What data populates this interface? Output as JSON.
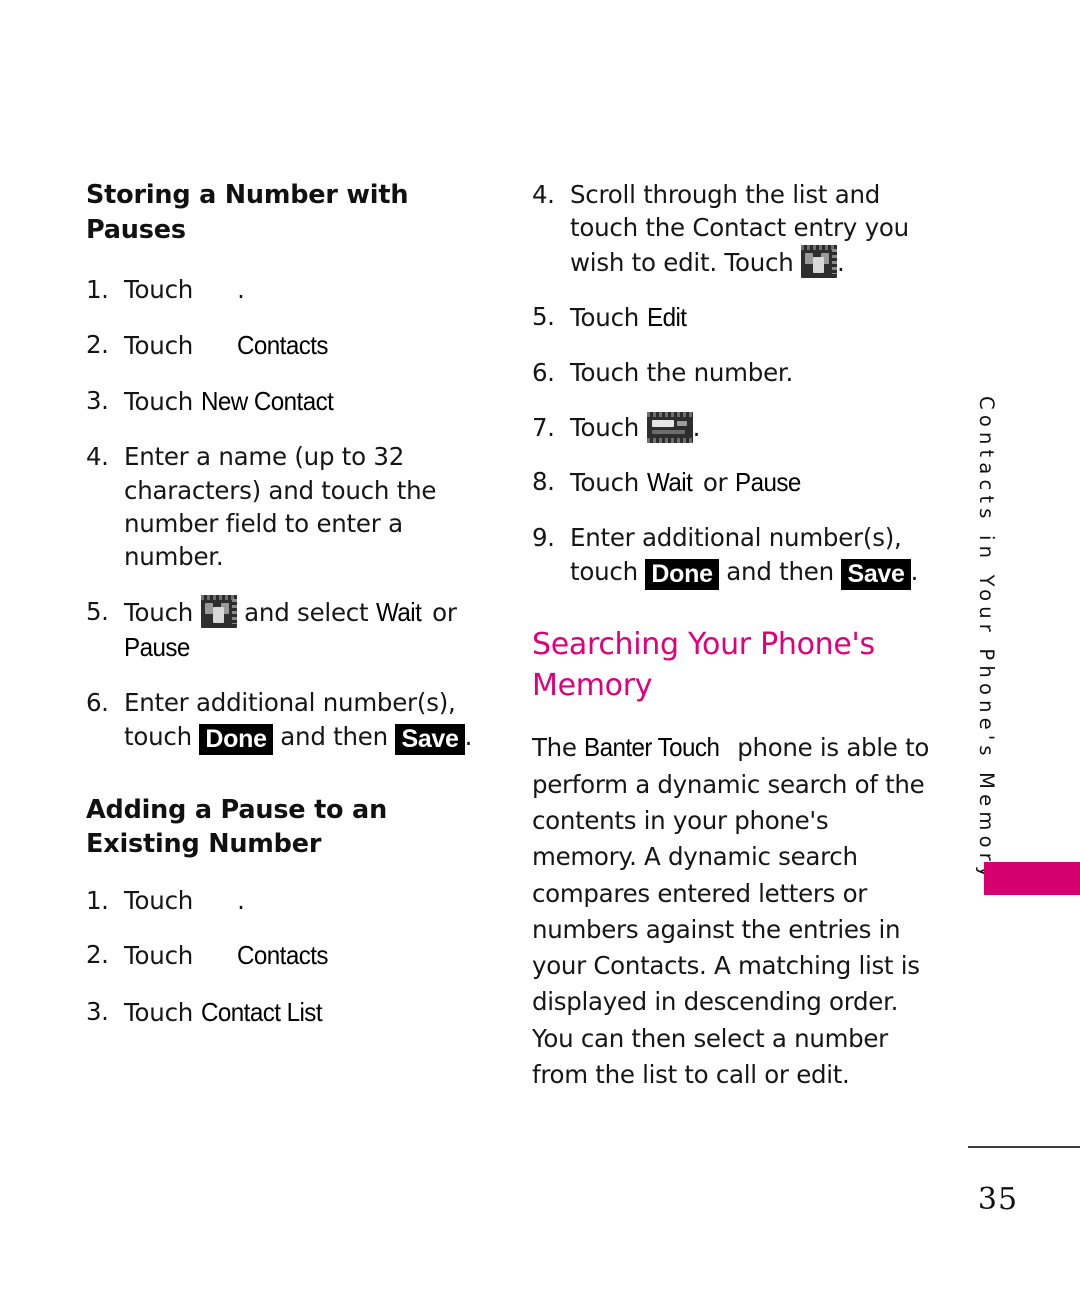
{
  "page": {
    "number": "35",
    "side_tab_label": "Contacts in Your Phone's Memory",
    "accent_pink": "#D4006E",
    "heading_pink": "#E0007C"
  },
  "left_column": {
    "heading_1": "Storing a Number with Pauses",
    "steps_1": [
      {
        "num": "1.",
        "lead": "Touch",
        "icon": "missing-icon-placeholder",
        "tail": "."
      },
      {
        "num": "2.",
        "lead": "Touch",
        "icon": "missing-icon-placeholder",
        "ui_label": "Contacts",
        "tail": ""
      },
      {
        "num": "3.",
        "lead": "Touch",
        "ui_label": "New Contact",
        "tail": ""
      },
      {
        "num": "4.",
        "text": "Enter a name (up to 32 characters) and touch the number field to enter a number."
      },
      {
        "num": "5.",
        "lead": "Touch",
        "icon": "contacts-screen-thumbnail",
        "mid": "and select",
        "ui_label_a": "Wait",
        "conj": "or",
        "ui_label_b": "Pause",
        "tail": ""
      },
      {
        "num": "6.",
        "lead": "Enter additional number(s), touch",
        "key_a": "Done",
        "mid": "and then",
        "key_b": "Save",
        "tail": "."
      }
    ],
    "heading_2": "Adding a Pause to an Existing Number",
    "steps_2": [
      {
        "num": "1.",
        "lead": "Touch",
        "icon": "missing-icon-placeholder",
        "tail": "."
      },
      {
        "num": "2.",
        "lead": "Touch",
        "icon": "missing-icon-placeholder",
        "ui_label": "Contacts",
        "tail": ""
      },
      {
        "num": "3.",
        "lead": "Touch",
        "ui_label": "Contact List",
        "tail": ""
      }
    ]
  },
  "right_column": {
    "steps": [
      {
        "num": "4.",
        "lead": "Scroll through the list and touch the Contact entry you wish to edit. Touch",
        "icon": "contacts-screen-thumbnail",
        "tail": "."
      },
      {
        "num": "5.",
        "lead": "Touch",
        "ui_label": "Edit",
        "tail": ""
      },
      {
        "num": "6.",
        "text": "Touch the number."
      },
      {
        "num": "7.",
        "lead": "Touch",
        "icon": "menu-screen-thumbnail",
        "tail": "."
      },
      {
        "num": "8.",
        "lead": "Touch",
        "ui_label_a": "Wait",
        "conj": "or",
        "ui_label_b": "Pause",
        "tail": ""
      },
      {
        "num": "9.",
        "lead": "Enter additional number(s), touch",
        "key_a": "Done",
        "mid": "and then",
        "key_b": "Save",
        "tail": "."
      }
    ],
    "section_heading": "Searching Your Phone's Memory",
    "paragraph_lead": "The",
    "paragraph_product": "Banter Touch",
    "paragraph_rest": "phone is able to perform a dynamic search of the contents in your phone's memory. A dynamic search compares entered letters or numbers against the entries in your Contacts. A matching list is displayed in descending order. You can then select a number from the list to call or edit."
  }
}
